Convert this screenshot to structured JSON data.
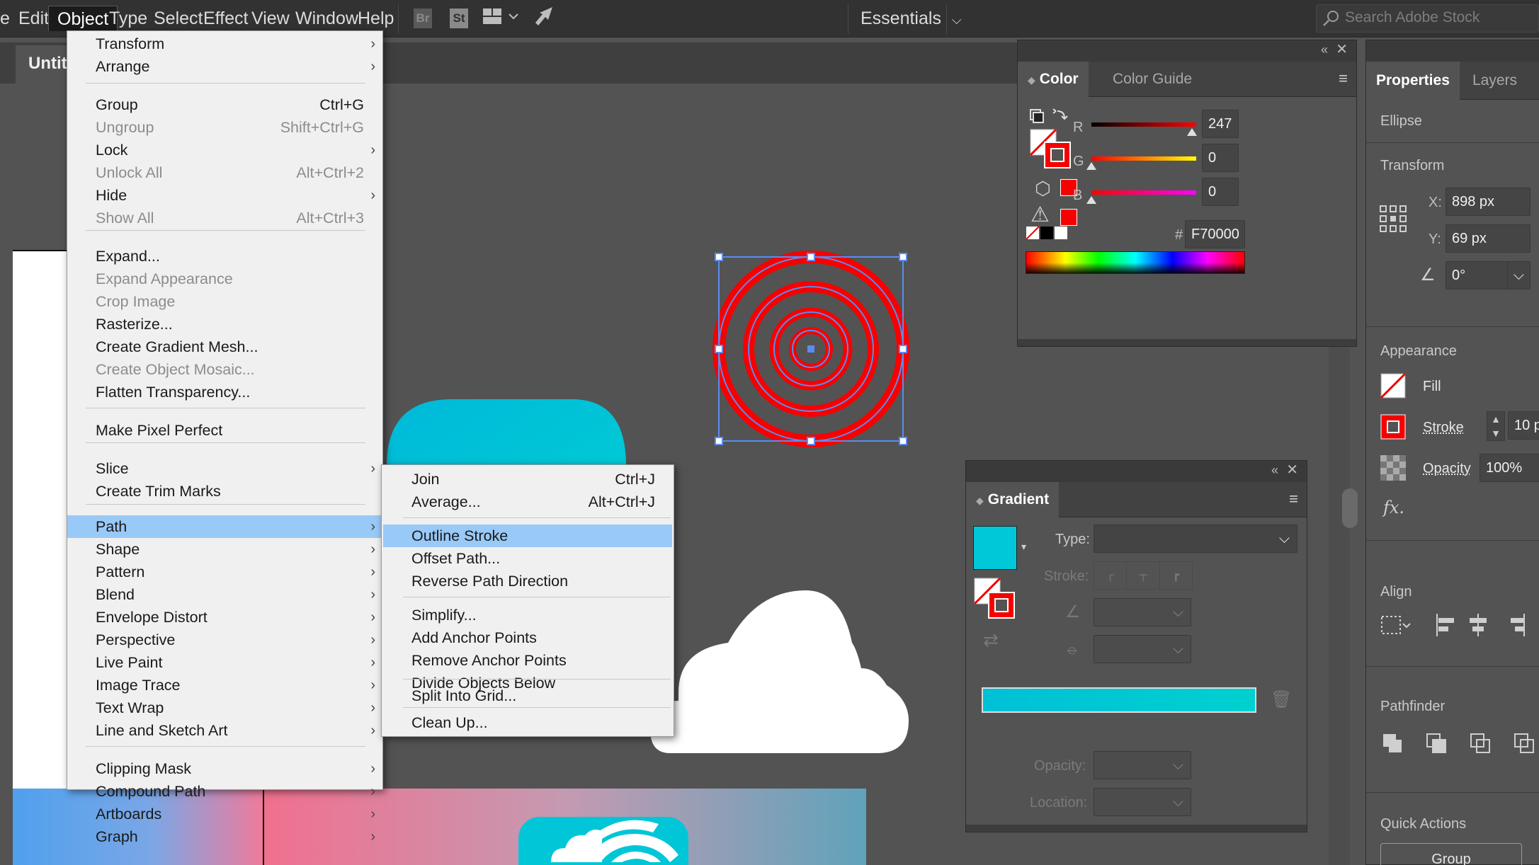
{
  "menubar": {
    "items": [
      "Edit",
      "Object",
      "Type",
      "Select",
      "Effect",
      "View",
      "Window",
      "Help"
    ],
    "open_item": "Object",
    "bridge_label": "Br",
    "stock_label": "St",
    "workspace": "Essentials",
    "search_placeholder": "Search Adobe Stock"
  },
  "document": {
    "tab_title": "Untit"
  },
  "object_menu": {
    "items": [
      {
        "label": "Transform",
        "submenu": true
      },
      {
        "label": "Arrange",
        "submenu": true
      },
      {
        "label": "Group",
        "shortcut": "Ctrl+G"
      },
      {
        "label": "Ungroup",
        "shortcut": "Shift+Ctrl+G",
        "disabled": true
      },
      {
        "label": "Lock",
        "submenu": true
      },
      {
        "label": "Unlock All",
        "shortcut": "Alt+Ctrl+2",
        "disabled": true
      },
      {
        "label": "Hide",
        "submenu": true
      },
      {
        "label": "Show All",
        "shortcut": "Alt+Ctrl+3",
        "disabled": true
      },
      {
        "label": "Expand..."
      },
      {
        "label": "Expand Appearance",
        "disabled": true
      },
      {
        "label": "Crop Image",
        "disabled": true
      },
      {
        "label": "Rasterize..."
      },
      {
        "label": "Create Gradient Mesh..."
      },
      {
        "label": "Create Object Mosaic...",
        "disabled": true
      },
      {
        "label": "Flatten Transparency..."
      },
      {
        "label": "Make Pixel Perfect"
      },
      {
        "label": "Slice",
        "submenu": true
      },
      {
        "label": "Create Trim Marks"
      },
      {
        "label": "Path",
        "submenu": true,
        "highlighted": true
      },
      {
        "label": "Shape",
        "submenu": true
      },
      {
        "label": "Pattern",
        "submenu": true
      },
      {
        "label": "Blend",
        "submenu": true
      },
      {
        "label": "Envelope Distort",
        "submenu": true
      },
      {
        "label": "Perspective",
        "submenu": true
      },
      {
        "label": "Live Paint",
        "submenu": true
      },
      {
        "label": "Image Trace",
        "submenu": true
      },
      {
        "label": "Text Wrap",
        "submenu": true
      },
      {
        "label": "Line and Sketch Art",
        "submenu": true
      },
      {
        "label": "Clipping Mask",
        "submenu": true
      },
      {
        "label": "Compound Path",
        "submenu": true
      },
      {
        "label": "Artboards",
        "submenu": true
      },
      {
        "label": "Graph",
        "submenu": true
      }
    ]
  },
  "path_submenu": {
    "items": [
      {
        "label": "Join",
        "shortcut": "Ctrl+J"
      },
      {
        "label": "Average...",
        "shortcut": "Alt+Ctrl+J"
      },
      {
        "label": "Outline Stroke",
        "highlighted": true
      },
      {
        "label": "Offset Path..."
      },
      {
        "label": "Reverse Path Direction"
      },
      {
        "label": "Simplify..."
      },
      {
        "label": "Add Anchor Points"
      },
      {
        "label": "Remove Anchor Points"
      },
      {
        "label": "Divide Objects Below"
      },
      {
        "label": "Split Into Grid..."
      },
      {
        "label": "Clean Up..."
      }
    ]
  },
  "color_panel": {
    "tabs": [
      "Color",
      "Color Guide"
    ],
    "r_label": "R",
    "r_value": "247",
    "g_label": "G",
    "g_value": "0",
    "b_label": "B",
    "b_value": "0",
    "hash": "#",
    "hex": "F70000",
    "accent": "#f70000"
  },
  "gradient_panel": {
    "title": "Gradient",
    "type_label": "Type:",
    "stroke_label": "Stroke:",
    "opacity_label": "Opacity:",
    "location_label": "Location:",
    "gradient_color": "#00c8d8"
  },
  "properties_panel": {
    "tabs": [
      "Properties",
      "Layers"
    ],
    "object_type": "Ellipse",
    "transform_header": "Transform",
    "x_label": "X:",
    "x_value": "898 px",
    "y_label": "Y:",
    "y_value": "69 px",
    "angle_value": "0°",
    "appearance_header": "Appearance",
    "fill_label": "Fill",
    "stroke_label": "Stroke",
    "stroke_weight": "10 p",
    "opacity_label": "Opacity",
    "opacity_value": "100%",
    "fx_label": "fx.",
    "align_header": "Align",
    "pathfinder_header": "Pathfinder",
    "quick_actions_header": "Quick Actions",
    "group_button": "Group"
  }
}
